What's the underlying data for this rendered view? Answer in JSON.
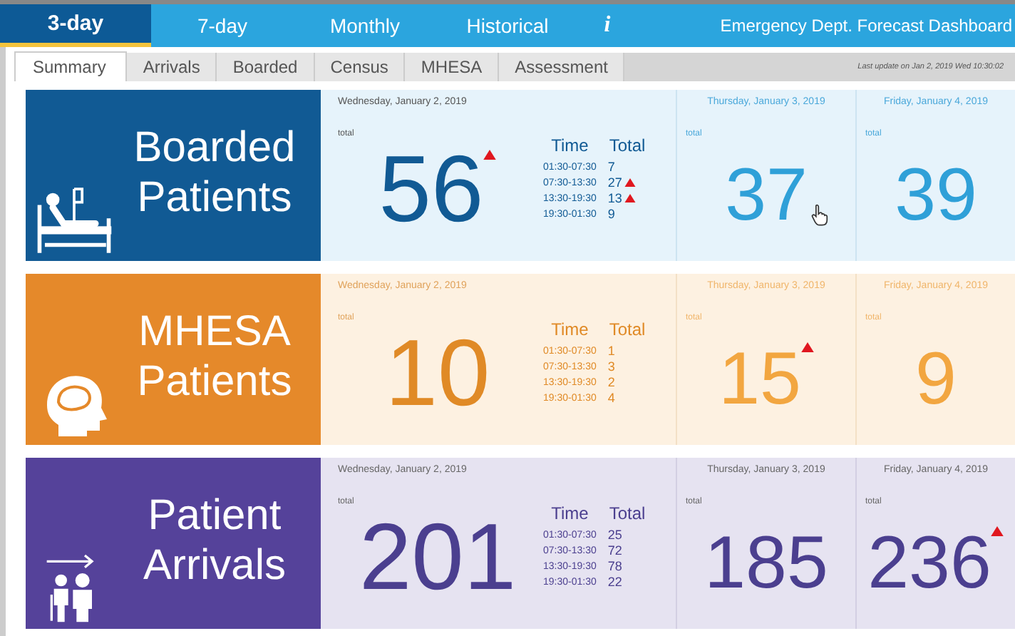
{
  "nav": [
    {
      "label": "3-day",
      "selected": true
    },
    {
      "label": "7-day",
      "selected": false
    },
    {
      "label": "Monthly",
      "selected": false
    },
    {
      "label": "Historical",
      "selected": false
    },
    {
      "label": "i",
      "selected": false
    }
  ],
  "title": "Emergency Dept. Forecast Dashboard",
  "tabs": [
    {
      "label": "Summary",
      "selected": true
    },
    {
      "label": "Arrivals",
      "selected": false
    },
    {
      "label": "Boarded",
      "selected": false
    },
    {
      "label": "Census",
      "selected": false
    },
    {
      "label": "MHESA",
      "selected": false
    },
    {
      "label": "Assessment",
      "selected": false
    }
  ],
  "last_update": "Last update on Jan 2, 2019 Wed 10:30:02",
  "sections": [
    {
      "kind": "boarded",
      "color": "#115a94",
      "title_lines": [
        "Boarded",
        "Patients"
      ],
      "today": {
        "date": "Wednesday, January 2, 2019",
        "label": "total",
        "value": "56",
        "alert": true,
        "table_headers": [
          "Time",
          "Total"
        ],
        "rows": [
          {
            "time": "01:30-07:30",
            "total": "7",
            "alert": false
          },
          {
            "time": "07:30-13:30",
            "total": "27",
            "alert": true
          },
          {
            "time": "13:30-19:30",
            "total": "13",
            "alert": true
          },
          {
            "time": "19:30-01:30",
            "total": "9",
            "alert": false
          }
        ]
      },
      "days": [
        {
          "date": "Thursday, January 3, 2019",
          "label": "total",
          "value": "37",
          "alert": false
        },
        {
          "date": "Friday, January 4, 2019",
          "label": "total",
          "value": "39",
          "alert": false
        }
      ]
    },
    {
      "kind": "mhesa",
      "color": "#e5892a",
      "title_lines": [
        "MHESA",
        "Patients"
      ],
      "today": {
        "date": "Wednesday, January 2, 2019",
        "label": "total",
        "value": "10",
        "alert": false,
        "table_headers": [
          "Time",
          "Total"
        ],
        "rows": [
          {
            "time": "01:30-07:30",
            "total": "1",
            "alert": false
          },
          {
            "time": "07:30-13:30",
            "total": "3",
            "alert": false
          },
          {
            "time": "13:30-19:30",
            "total": "2",
            "alert": false
          },
          {
            "time": "19:30-01:30",
            "total": "4",
            "alert": false
          }
        ]
      },
      "days": [
        {
          "date": "Thursday, January 3, 2019",
          "label": "total",
          "value": "15",
          "alert": true
        },
        {
          "date": "Friday, January 4, 2019",
          "label": "total",
          "value": "9",
          "alert": false
        }
      ]
    },
    {
      "kind": "arrivals",
      "color": "#55429a",
      "title_lines": [
        "Patient",
        "Arrivals"
      ],
      "today": {
        "date": "Wednesday, January 2, 2019",
        "label": "total",
        "value": "201",
        "alert": false,
        "table_headers": [
          "Time",
          "Total"
        ],
        "rows": [
          {
            "time": "01:30-07:30",
            "total": "25",
            "alert": false
          },
          {
            "time": "07:30-13:30",
            "total": "72",
            "alert": false
          },
          {
            "time": "13:30-19:30",
            "total": "78",
            "alert": false
          },
          {
            "time": "19:30-01:30",
            "total": "22",
            "alert": false
          }
        ]
      },
      "days": [
        {
          "date": "Thursday, January 3, 2019",
          "label": "total",
          "value": "185",
          "alert": false
        },
        {
          "date": "Friday, January 4, 2019",
          "label": "total",
          "value": "236",
          "alert": true
        }
      ]
    }
  ]
}
